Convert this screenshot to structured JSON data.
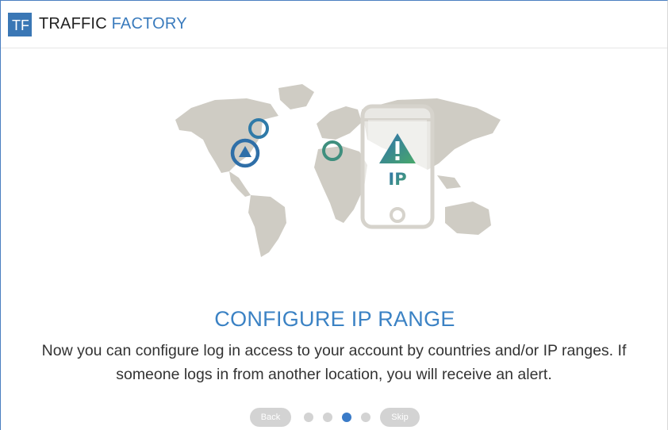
{
  "header": {
    "logo_letters": "TF",
    "brand_primary": "TRAFFIC",
    "brand_secondary": "FACTORY"
  },
  "hero": {
    "phone_label": "IP",
    "icons": [
      "world-map",
      "phone-with-warning",
      "location-ring",
      "warning-icon"
    ]
  },
  "main": {
    "title": "CONFIGURE IP RANGE",
    "description_line1": "Now you can configure log in access to your account by countries and/or IP ranges. If",
    "description_line2": "someone logs in from another location, you will receive an alert."
  },
  "pager": {
    "back_label": "Back",
    "skip_label": "Skip",
    "total_steps": 4,
    "active_step": 3
  },
  "colors": {
    "accent": "#3a7bbd",
    "map": "#cfccc4",
    "ring_blue": "#2f6fa8",
    "ring_green": "#4aa56a",
    "pill": "#d3d3d3"
  }
}
